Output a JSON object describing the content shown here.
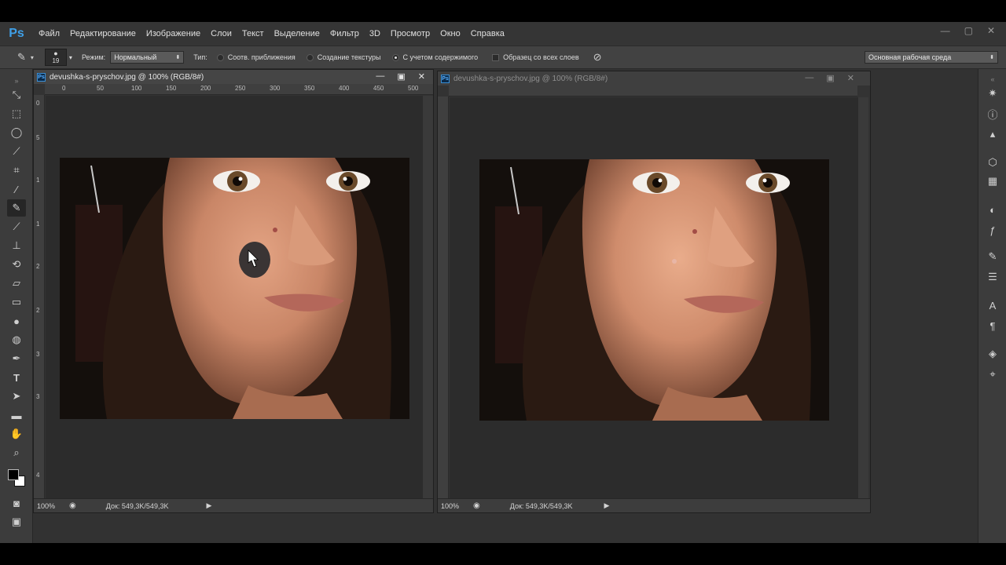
{
  "app": {
    "logo": "Ps"
  },
  "menu": [
    "Файл",
    "Редактирование",
    "Изображение",
    "Слои",
    "Текст",
    "Выделение",
    "Фильтр",
    "3D",
    "Просмотр",
    "Окно",
    "Справка"
  ],
  "window_controls": [
    "—",
    "▢",
    "✕"
  ],
  "options": {
    "brush_size": "19",
    "mode_label": "Режим:",
    "mode_value": "Нормальный",
    "type_label": "Тип:",
    "type_options": [
      "Соотв. приближения",
      "Создание текстуры",
      "С учетом содержимого"
    ],
    "selected_type": "С учетом содержимого",
    "sample_all_layers": "Образец со всех слоев",
    "workspace": "Основная рабочая среда"
  },
  "documents": [
    {
      "title": "devushka-s-pryschov.jpg @ 100% (RGB/8#)",
      "active": true,
      "zoom": "100%",
      "doc_info": "Док: 549,3K/549,3K",
      "ruler_ticks": [
        "0",
        "50",
        "100",
        "150",
        "200",
        "250",
        "300",
        "350",
        "400",
        "450",
        "500"
      ]
    },
    {
      "title": "devushka-s-pryschov.jpg @ 100% (RGB/8#)",
      "active": false,
      "zoom": "100%",
      "doc_info": "Док: 549,3K/549,3K"
    }
  ],
  "vertical_ruler_ticks": [
    "0",
    "5",
    "1",
    "1",
    "2",
    "2",
    "3",
    "3",
    "4"
  ],
  "icons": {
    "tools": [
      "move-icon",
      "marquee-icon",
      "lasso-icon",
      "quick-select-icon",
      "crop-icon",
      "eyedropper-icon",
      "spot-healing-brush-icon",
      "brush-icon",
      "clone-stamp-icon",
      "history-brush-icon",
      "eraser-icon",
      "gradient-icon",
      "blur-icon",
      "dodge-icon",
      "pen-icon",
      "type-icon",
      "path-select-icon",
      "rectangle-icon",
      "hand-icon",
      "zoom-icon"
    ],
    "panels": [
      "adjustments-icon",
      "info-icon",
      "histogram-icon",
      "3d-icon",
      "grid-icon",
      "color-icon",
      "fx-icon",
      "brush-preset-icon",
      "properties-icon",
      "character-icon",
      "paragraph-icon",
      "layers-icon",
      "paths-icon"
    ]
  },
  "colors": {
    "accent": "#3fa0e8",
    "background": "#323232",
    "panel": "#3c3c3c"
  }
}
